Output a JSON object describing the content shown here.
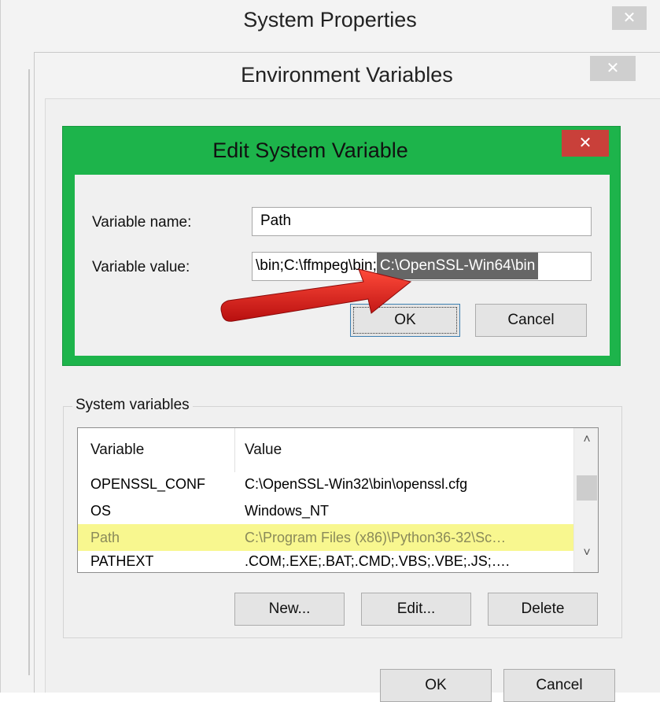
{
  "system_properties": {
    "title": "System Properties",
    "close_glyph": "✕"
  },
  "environment_variables": {
    "title": "Environment Variables",
    "close_glyph": "✕"
  },
  "edit_system_variable": {
    "title": "Edit System Variable",
    "close_glyph": "✕",
    "name_label": "Variable name:",
    "name_value": "Path",
    "value_label": "Variable value:",
    "value_visible_plain": "\\bin;C:\\ffmpeg\\bin;",
    "value_visible_selected": "C:\\OpenSSL-Win64\\bin",
    "ok_label": "OK",
    "cancel_label": "Cancel"
  },
  "system_variables": {
    "group_label": "System variables",
    "columns": [
      "Variable",
      "Value"
    ],
    "rows": [
      {
        "name": "OPENSSL_CONF",
        "value": "C:\\OpenSSL-Win32\\bin\\openssl.cfg"
      },
      {
        "name": "OS",
        "value": "Windows_NT"
      },
      {
        "name": "Path",
        "value": "C:\\Program Files (x86)\\Python36-32\\Sc…"
      },
      {
        "name": "PATHEXT",
        "value": ".COM;.EXE;.BAT;.CMD;.VBS;.VBE;.JS;…."
      }
    ],
    "highlighted_row": "Path",
    "new_label": "New...",
    "edit_label": "Edit...",
    "delete_label": "Delete",
    "scroll_up_glyph": "˄",
    "scroll_down_glyph": "˅"
  },
  "footer": {
    "ok_label": "OK",
    "cancel_label": "Cancel"
  },
  "colors": {
    "dialog_frame": "#1db44b",
    "close_red": "#c9403a",
    "selection": "#666666",
    "row_highlight": "#f8f78f",
    "arrow": "#e21b1b"
  }
}
